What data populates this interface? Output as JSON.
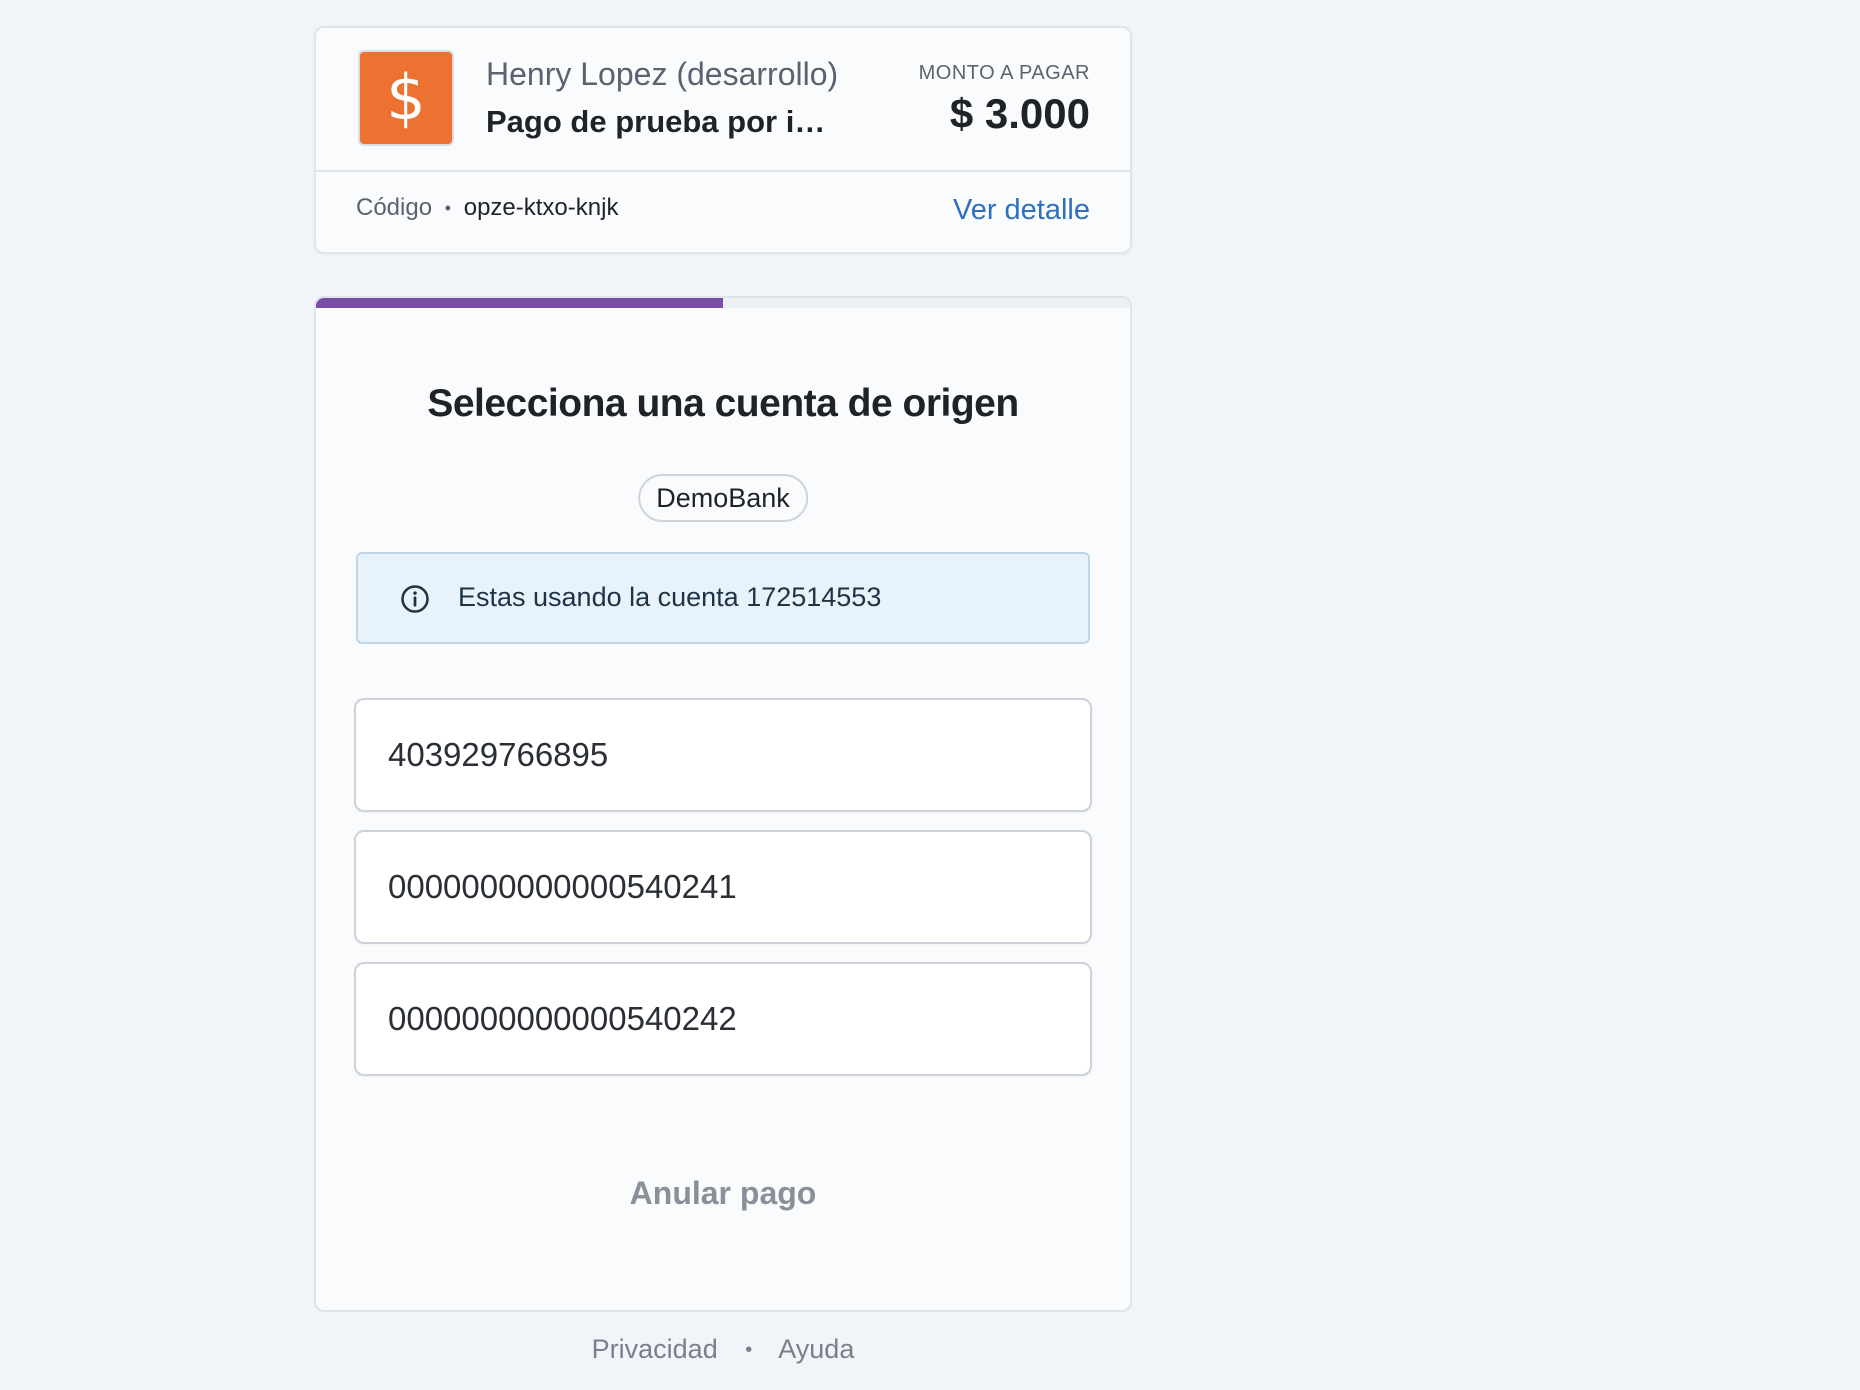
{
  "summary": {
    "merchant_logo_symbol": "$",
    "merchant_logo_color": "#ec7232",
    "merchant_name": "Henry Lopez (desarrollo)",
    "payment_subject": "Pago de prueba por integración",
    "amount_label": "MONTO A PAGAR",
    "amount_value": "$ 3.000",
    "code_label": "Código",
    "code_separator": "•",
    "code_value": "opze-ktxo-knjk",
    "detail_link": "Ver detalle"
  },
  "progress": {
    "value": 0.5,
    "color": "#7a4ea6"
  },
  "main": {
    "title": "Selecciona una cuenta de origen",
    "bank_name": "DemoBank",
    "info_icon": "info-circle-icon",
    "info_text": "Estas usando la cuenta 172514553",
    "accounts": [
      "403929766895",
      "0000000000000540241",
      "0000000000000540242"
    ],
    "cancel_label": "Anular pago"
  },
  "footer": {
    "privacy": "Privacidad",
    "separator": "•",
    "help": "Ayuda"
  }
}
